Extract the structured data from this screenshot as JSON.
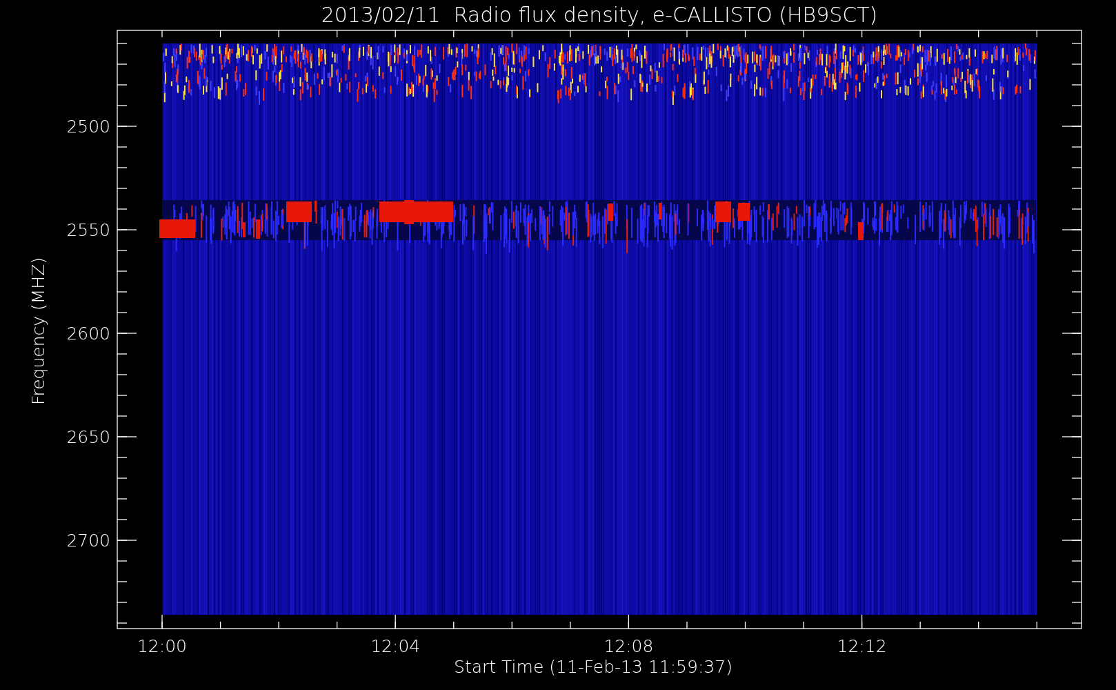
{
  "title": "2013/02/11  Radio flux density, e-CALLISTO (HB9SCT)",
  "y_axis": {
    "label": "Frequency (MHZ)",
    "ticks": [
      "2500",
      "2550",
      "2600",
      "2650",
      "2700"
    ]
  },
  "x_axis": {
    "label": "Start Time (11-Feb-13 11:59:37)",
    "ticks": [
      "12:00",
      "12:04",
      "12:08",
      "12:12"
    ]
  }
}
